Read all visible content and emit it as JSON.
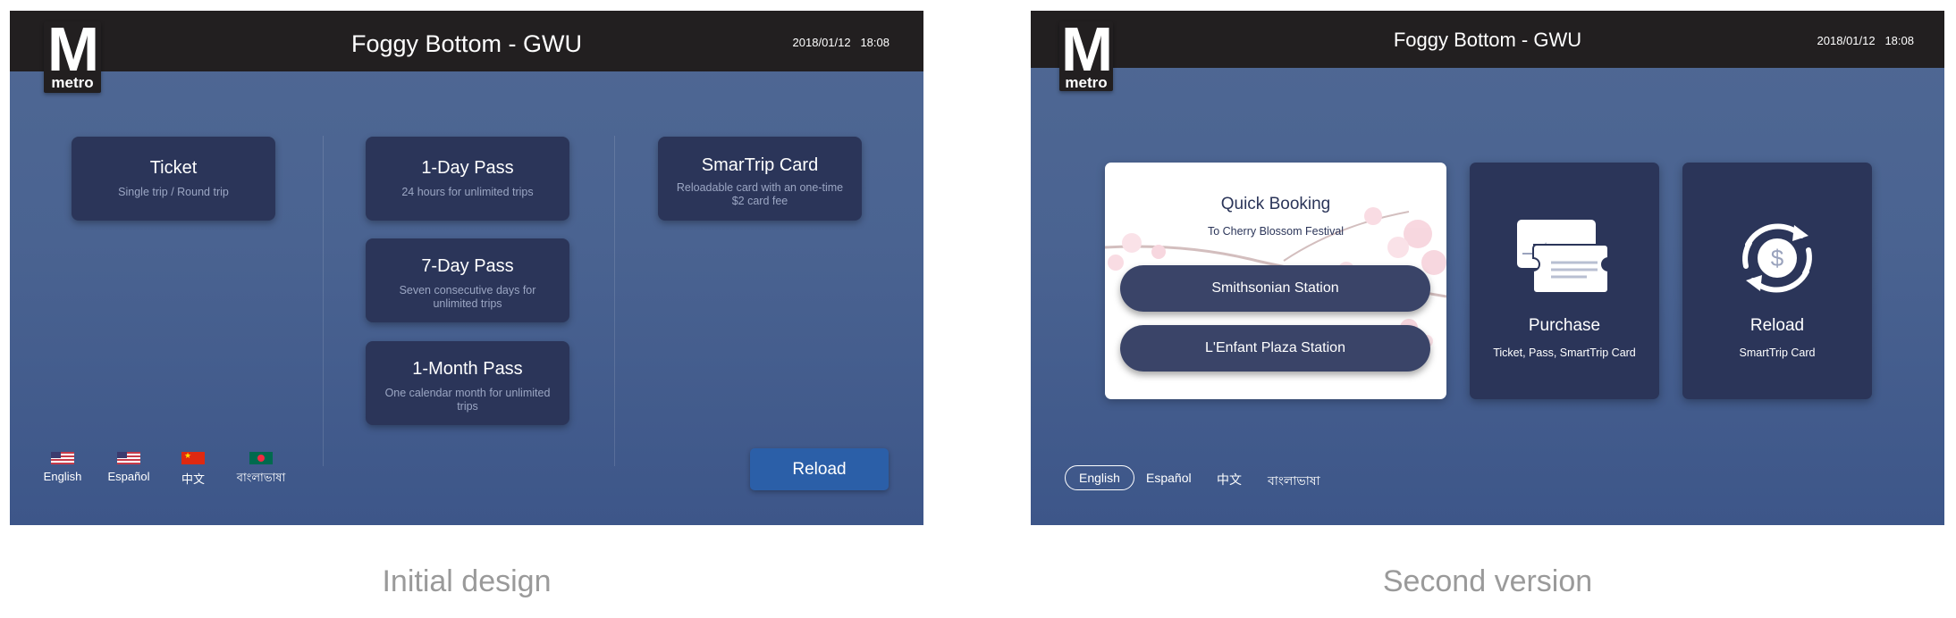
{
  "initial": {
    "station": "Foggy Bottom - GWU",
    "date": "2018/01/12",
    "time": "18:08",
    "logo": {
      "letter": "M",
      "word": "metro"
    },
    "cards": [
      {
        "title": "Ticket",
        "subtitle": "Single trip / Round trip"
      },
      {
        "title": "1-Day Pass",
        "subtitle": "24 hours for unlimited trips"
      },
      {
        "title": "7-Day Pass",
        "subtitle": "Seven consecutive days for unlimited trips"
      },
      {
        "title": "1-Month Pass",
        "subtitle": "One calendar month for unlimited trips"
      },
      {
        "title": "SmarTrip Card",
        "subtitle": "Reloadable card with an one-time $2 card fee"
      }
    ],
    "languages": [
      "English",
      "Español",
      "中文",
      "বাংলাভাষা"
    ],
    "reload_label": "Reload",
    "caption": "Initial design"
  },
  "second": {
    "station": "Foggy Bottom - GWU",
    "date": "2018/01/12",
    "time": "18:08",
    "logo": {
      "letter": "M",
      "word": "metro"
    },
    "quick_booking": {
      "title": "Quick Booking",
      "subtitle": "To Cherry Blossom Festival",
      "stations": [
        "Smithsonian Station",
        "L'Enfant Plaza Station"
      ]
    },
    "purchase": {
      "title": "Purchase",
      "subtitle": "Ticket, Pass, SmartTrip Card",
      "icon": "ticket-icon"
    },
    "reload": {
      "title": "Reload",
      "subtitle": "SmartTrip Card",
      "icon": "reload-dollar-icon"
    },
    "languages": [
      "English",
      "Español",
      "中文",
      "বাংলাভাষা"
    ],
    "selected_language": "English",
    "caption": "Second version"
  },
  "colors": {
    "topbar": "#221f20",
    "card": "#2b3559",
    "reload_button": "#2b5fa8",
    "background_top": "#4f6894",
    "background_bottom": "#3d5689"
  }
}
